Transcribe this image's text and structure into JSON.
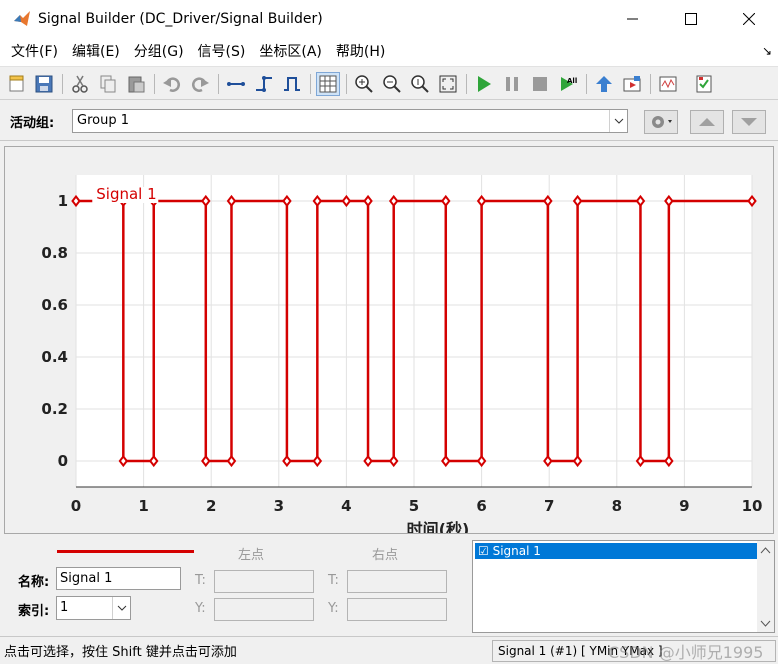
{
  "window": {
    "title": "Signal Builder (DC_Driver/Signal Builder)"
  },
  "menu": {
    "items": [
      "文件(F)",
      "编辑(E)",
      "分组(G)",
      "信号(S)",
      "坐标区(A)",
      "帮助(H)"
    ]
  },
  "toolbar": {
    "icons": [
      "new-icon",
      "save-icon",
      "cut-icon",
      "copy-icon",
      "paste-icon",
      "undo-icon",
      "redo-icon",
      "constant-segment-icon",
      "step-icon",
      "pulse-icon",
      "grid-icon",
      "zoom-in-xy-icon",
      "zoom-in-x-icon",
      "zoom-in-y-icon",
      "fit-icon",
      "start-icon",
      "pause-icon",
      "stop-icon",
      "run-all-icon",
      "up-icon",
      "goto-block-icon",
      "scope-icon",
      "verification-icon"
    ]
  },
  "group": {
    "label": "活动组:",
    "selected": "Group 1"
  },
  "colors": {
    "signal": "#d40000",
    "selection": "#0078d7"
  },
  "chart_data": {
    "type": "line",
    "series": [
      {
        "name": "Signal 1",
        "x": [
          0,
          0.7,
          0.7,
          1.15,
          1.15,
          1.92,
          1.92,
          2.3,
          2.3,
          3.12,
          3.12,
          3.57,
          3.57,
          4.0,
          4.32,
          4.32,
          4.7,
          4.7,
          5.47,
          5.47,
          6.0,
          6.0,
          6.98,
          6.98,
          7.42,
          7.42,
          8.35,
          8.35,
          8.77,
          8.77,
          10
        ],
        "y": [
          1,
          1,
          0,
          0,
          1,
          1,
          0,
          0,
          1,
          1,
          0,
          0,
          1,
          1,
          1,
          0,
          0,
          1,
          1,
          0,
          0,
          1,
          1,
          0,
          0,
          1,
          1,
          0,
          0,
          1,
          1
        ]
      }
    ],
    "xlabel": "时间(秒)",
    "ylabel": "",
    "xlim": [
      0,
      10
    ],
    "ylim": [
      -0.1,
      1.1
    ],
    "xticks": [
      "0",
      "1",
      "2",
      "3",
      "4",
      "5",
      "6",
      "7",
      "8",
      "9",
      "10"
    ],
    "yticks": [
      "0",
      "0.2",
      "0.4",
      "0.6",
      "0.8",
      "1"
    ],
    "grid": true,
    "series_label": "Signal 1"
  },
  "props": {
    "name_label": "名称:",
    "name_value": "Signal 1",
    "index_label": "索引:",
    "index_value": "1",
    "left_point": "左点",
    "right_point": "右点",
    "t_label": "T:",
    "y_label": "Y:"
  },
  "signal_list": {
    "items": [
      "☑ Signal 1"
    ]
  },
  "status": {
    "hint": "点击可选择，按住 Shift 键并点击可添加",
    "info": "Signal 1 (#1)  [ YMin YMax ]",
    "watermark": "CSDN @小师兄1995"
  }
}
